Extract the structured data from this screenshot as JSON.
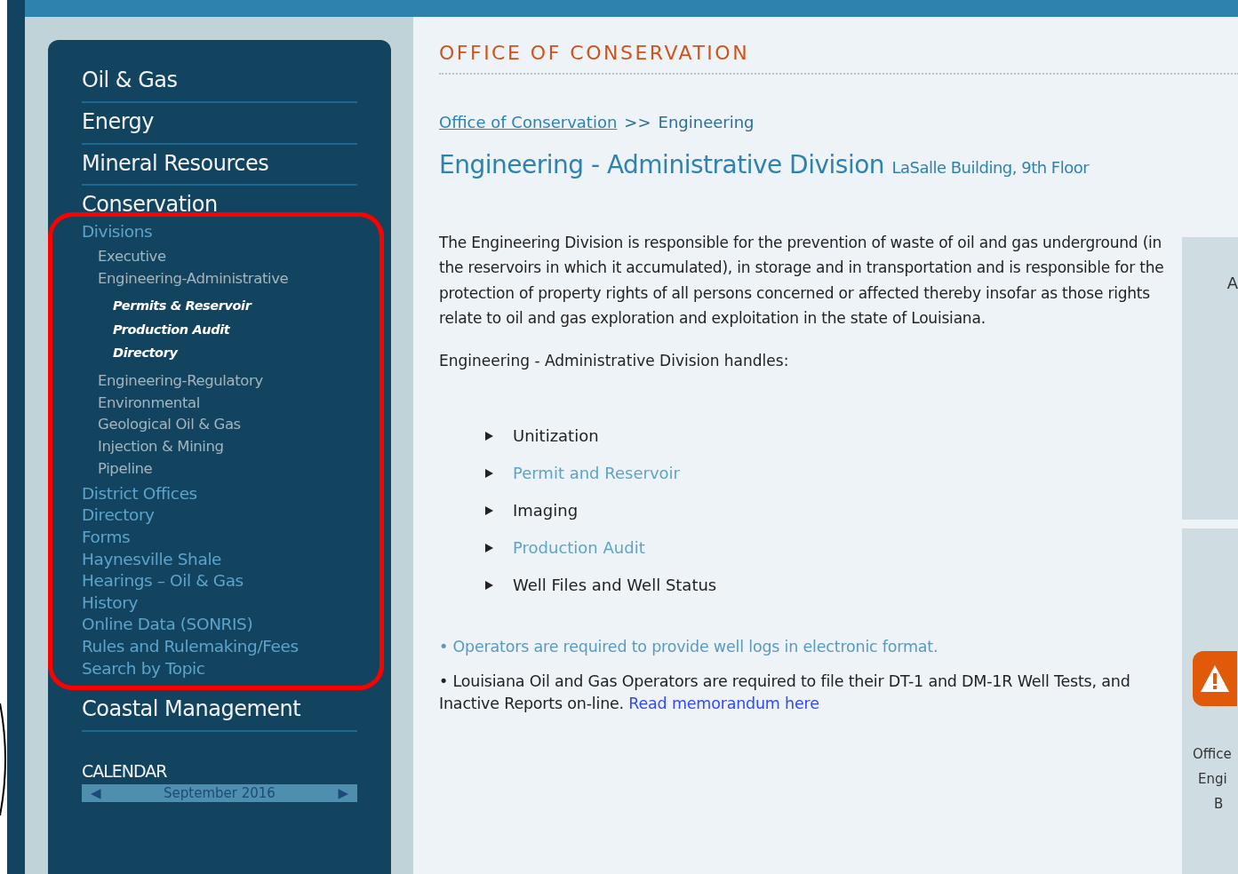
{
  "sidebar": {
    "sections": [
      {
        "label": "Oil & Gas"
      },
      {
        "label": "Energy"
      },
      {
        "label": "Mineral Resources"
      },
      {
        "label": "Conservation",
        "links_highlighted": true,
        "children": [
          {
            "label": "Divisions",
            "children": [
              {
                "label": "Executive"
              },
              {
                "label": "Engineering-Administrative",
                "children": [
                  {
                    "label": "Permits & Reservoir"
                  },
                  {
                    "label": "Production Audit"
                  },
                  {
                    "label": "Directory"
                  }
                ]
              },
              {
                "label": "Engineering-Regulatory"
              },
              {
                "label": "Environmental"
              },
              {
                "label": "Geological Oil & Gas"
              },
              {
                "label": "Injection & Mining"
              },
              {
                "label": "Pipeline"
              }
            ]
          },
          {
            "label": "District Offices"
          },
          {
            "label": "Directory"
          },
          {
            "label": "Forms"
          },
          {
            "label": "Haynesville Shale"
          },
          {
            "label": "Hearings – Oil & Gas"
          },
          {
            "label": "History"
          },
          {
            "label": "Online Data (SONRIS)"
          },
          {
            "label": "Rules and Rulemaking/Fees"
          },
          {
            "label": "Search by Topic"
          }
        ]
      },
      {
        "label": "Coastal Management"
      }
    ],
    "calendar": {
      "title": "CALENDAR",
      "prev": "◀",
      "month": "September 2016",
      "next": "▶"
    }
  },
  "content": {
    "section_title": "OFFICE OF CONSERVATION",
    "breadcrumb": [
      {
        "kind": "link",
        "label": "Office of Conservation"
      },
      {
        "kind": "separator",
        "label": ">>"
      },
      {
        "kind": "text",
        "label": "Engineering"
      }
    ],
    "heading": "Engineering - Administrative Division",
    "location": "LaSalle Building, 9th Floor",
    "intro": "The Engineering Division is responsible for the prevention of waste of oil and gas underground (in the reservoirs in which it accumulated), in storage and in transportation and is responsible for the protection of property rights of all persons concerned or affected thereby insofar as those rights relate to oil and gas exploration and exploitation in the state of Louisiana.",
    "handles_title": "Engineering - Administrative Division handles:",
    "handles": [
      {
        "label": "Unitization",
        "kind": "text"
      },
      {
        "label": "Permit and Reservoir",
        "kind": "link"
      },
      {
        "label": "Imaging",
        "kind": "text"
      },
      {
        "label": "Production Audit",
        "kind": "link"
      },
      {
        "label": "Well Files and Well Status",
        "kind": "text"
      }
    ],
    "notes": [
      {
        "text": "• Operators are required to provide well logs in electronic format.",
        "kind": "link"
      },
      {
        "text": "• Louisiana Oil and Gas Operators are required to file their DT-1 and DM-1R Well Tests, and Inactive Reports on-line.",
        "kind": "text",
        "link": "Read memorandum here"
      }
    ]
  },
  "right_panel": {
    "top_text": "A",
    "bottom_lines": [
      "Office",
      "Engi",
      "B"
    ]
  }
}
